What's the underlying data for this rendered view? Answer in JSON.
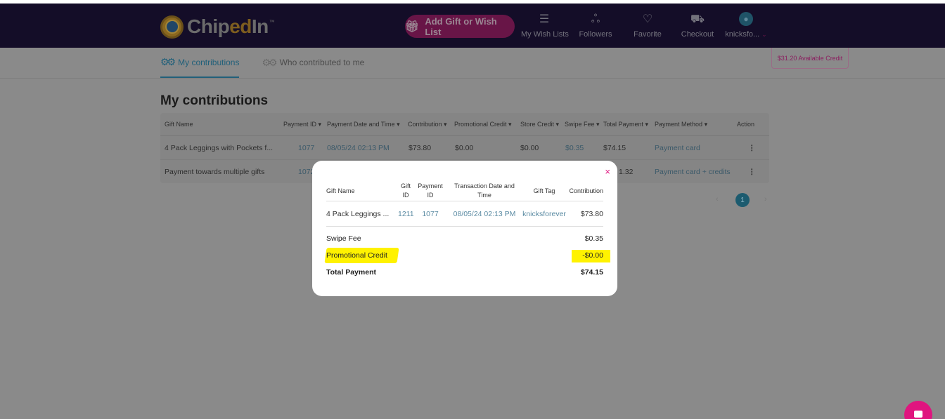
{
  "header": {
    "logo_prefix": "Chip",
    "logo_ed": "ed",
    "logo_suffix": "In",
    "logo_tm": "™",
    "add_button": "Add Gift or Wish List",
    "nav": [
      {
        "label": "My Wish Lists",
        "icon": "wishlist-icon"
      },
      {
        "label": "Followers",
        "icon": "followers-icon"
      },
      {
        "label": "Favorite",
        "icon": "heart-icon"
      },
      {
        "label": "Checkout",
        "icon": "cart-icon"
      },
      {
        "label": "knicksfo...",
        "icon": "user-avatar-icon"
      }
    ]
  },
  "credit_badge": "$31.20 Available Credit",
  "tabs": [
    {
      "label": "My contributions",
      "active": true
    },
    {
      "label": "Who contributed to me",
      "active": false
    }
  ],
  "page_title": "My contributions",
  "table": {
    "headers": [
      "Gift Name",
      "Payment ID",
      "Payment Date and Time",
      "Contribution",
      "Promotional Credit",
      "Store Credit",
      "Swipe Fee",
      "Total Payment",
      "Payment Method",
      "Action"
    ],
    "sort_arrow": "▾",
    "rows": [
      {
        "gift": "4 Pack Leggings with Pockets f...",
        "payment_id": "1077",
        "date": "08/05/24 02:13 PM",
        "contribution": "$73.80",
        "promo": "$0.00",
        "store": "$0.00",
        "swipe": "$0.35",
        "total": "$74.15",
        "method": "Payment card",
        "action": "⋮"
      },
      {
        "gift": "Payment towards multiple gifts",
        "payment_id": "1072",
        "total_fragment": "1.32",
        "method": "Payment card + credits",
        "action": "⋮"
      }
    ]
  },
  "pager": {
    "current": "1",
    "prev": "‹",
    "next": "›"
  },
  "modal": {
    "close": "×",
    "headers": {
      "gift_name": "Gift Name",
      "gift_id_1": "Gift",
      "gift_id_2": "ID",
      "payment_id_1": "Payment",
      "payment_id_2": "ID",
      "date_1": "Transaction Date and",
      "date_2": "Time",
      "tag": "Gift Tag",
      "contribution": "Contribution"
    },
    "row": {
      "gift_name": "4 Pack Leggings ...",
      "gift_id": "1211",
      "payment_id": "1077",
      "date": "08/05/24 02:13 PM",
      "tag": "knicksforever",
      "contribution": "$73.80"
    },
    "swipe_fee_label": "Swipe Fee",
    "swipe_fee_value": "$0.35",
    "promo_label": "Promotional Credit",
    "promo_value": "-$0.00",
    "total_label": "Total Payment",
    "total_value": "$74.15"
  },
  "colors": {
    "brand_dark": "#1b1236",
    "accent_pink": "#e0157f",
    "highlight": "#fff200",
    "link": "#5b8ba3"
  }
}
